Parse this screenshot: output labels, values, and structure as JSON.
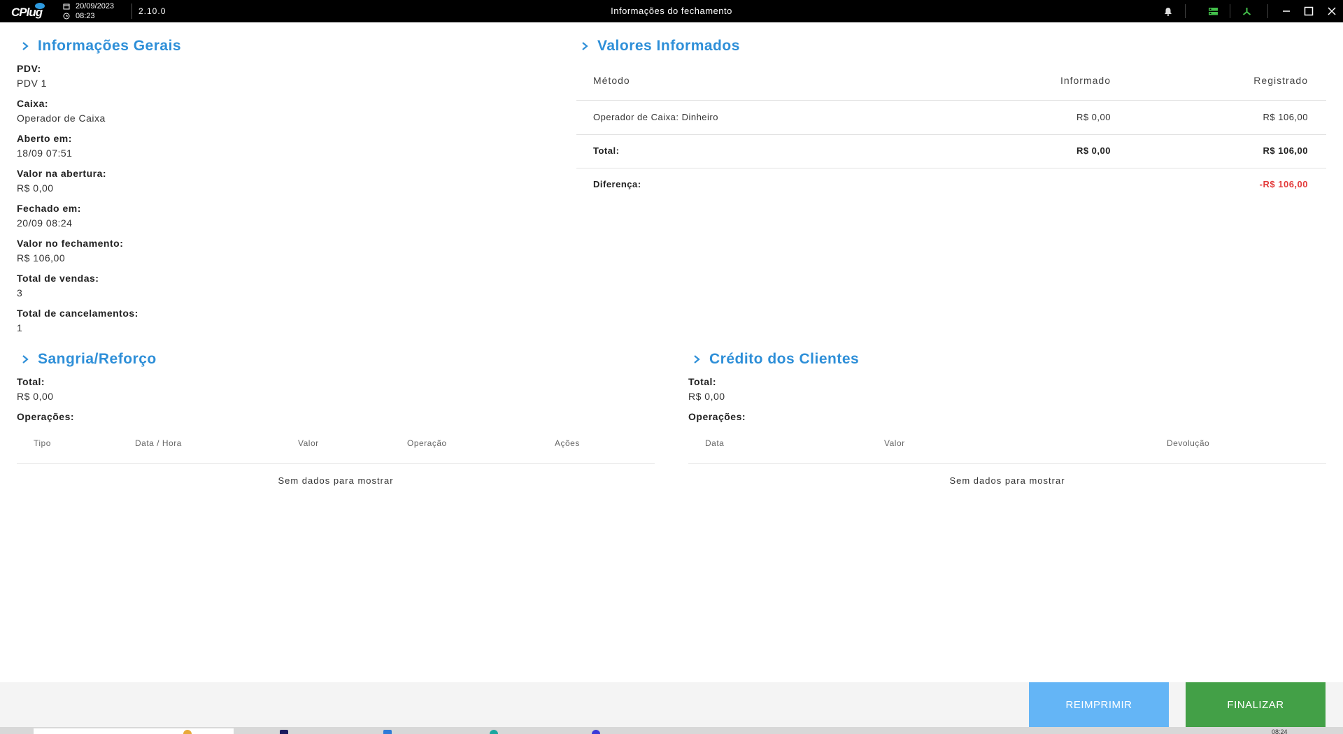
{
  "titlebar": {
    "logo": "CPlug",
    "date": "20/09/2023",
    "time": "08:23",
    "version": "2.10.0",
    "window_title": "Informações do fechamento",
    "icons": [
      "calendar-icon",
      "clock-icon",
      "bell-icon",
      "server-icon",
      "network-icon",
      "minimize-icon",
      "maximize-icon",
      "close-icon"
    ]
  },
  "general": {
    "title": "Informações Gerais",
    "fields": [
      {
        "label": "PDV:",
        "value": "PDV 1"
      },
      {
        "label": "Caixa:",
        "value": "Operador de Caixa"
      },
      {
        "label": "Aberto em:",
        "value": "18/09 07:51"
      },
      {
        "label": "Valor na abertura:",
        "value": "R$ 0,00"
      },
      {
        "label": "Fechado em:",
        "value": "20/09 08:24"
      },
      {
        "label": "Valor no fechamento:",
        "value": "R$ 106,00"
      },
      {
        "label": "Total de vendas:",
        "value": "3"
      },
      {
        "label": "Total de cancelamentos:",
        "value": "1"
      }
    ]
  },
  "valores": {
    "title": "Valores Informados",
    "columns": [
      "Método",
      "Informado",
      "Registrado"
    ],
    "rows": [
      {
        "method": "Operador de Caixa: Dinheiro",
        "informed": "R$ 0,00",
        "registered": "R$ 106,00"
      }
    ],
    "total_label": "Total:",
    "total_informed": "R$ 0,00",
    "total_registered": "R$ 106,00",
    "difference_label": "Diferença:",
    "difference_value": "-R$ 106,00"
  },
  "sangria": {
    "title": "Sangria/Reforço",
    "total_label": "Total:",
    "total_value": "R$ 0,00",
    "operations_label": "Operações:",
    "columns": [
      "Tipo",
      "Data / Hora",
      "Valor",
      "Operação",
      "Ações"
    ],
    "empty_message": "Sem dados para mostrar"
  },
  "credito": {
    "title": "Crédito dos Clientes",
    "total_label": "Total:",
    "total_value": "R$ 0,00",
    "operations_label": "Operações:",
    "columns": [
      "Data",
      "Valor",
      "Devolução"
    ],
    "empty_message": "Sem dados para mostrar"
  },
  "footer": {
    "reprint_label": "REIMPRIMIR",
    "finish_label": "FINALIZAR"
  },
  "taskbar": {
    "clock": "08:24"
  },
  "colors": {
    "accent": "#2e8fd8",
    "negative": "#e33b3b",
    "reprint_button": "#64b5f6",
    "finish_button": "#43a047"
  }
}
